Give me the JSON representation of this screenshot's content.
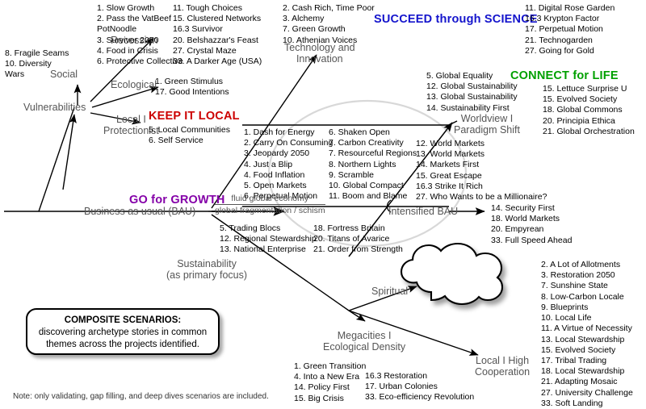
{
  "diagram": {
    "title_box": {
      "heading": "COMPOSITE SCENARIOS:",
      "body_line1": "discovering archetype stories in common",
      "body_line2": "themes across the projects identified."
    },
    "footnote": "Note: only validating, gap filling, and deep dives scenarios are included.",
    "colors": {
      "keep_it_local": "#cc0000",
      "succeed_through_science": "#1414cc",
      "connect_for_life": "#00a000",
      "go_for_growth": "#8400a8",
      "node_label": "#555555"
    },
    "nodes": {
      "bau": "Business as usual (BAU)",
      "vulnerabilities": "Vulnerabilities",
      "social": "Social",
      "ecological": "Ecological",
      "recession": "Recession",
      "local_protectionist_l1": "Local I",
      "local_protectionist_l2": "Protectionist",
      "technology_l1": "Technology and",
      "technology_l2": "Innovation",
      "worldview_l1": "Worldview I",
      "worldview_l2": "Paradigm Shift",
      "intensified_bau": "Intensified BAU",
      "sustainability_l1": "Sustainability",
      "sustainability_l2": "(as primary focus)",
      "spiritual": "Spiritual",
      "megacities_l1": "Megacities I",
      "megacities_l2": "Ecological Density",
      "local_high_coop_l1": "Local I High",
      "local_high_coop_l2": "Cooperation"
    },
    "fraction": {
      "numerator": "fluid global economy",
      "denominator": "global fragmentation / schism"
    },
    "headings": {
      "keep_it_local": "KEEP IT LOCAL",
      "succeed_through_science": "SUCCEED through SCIENCE",
      "connect_for_life": "CONNECT for LIFE",
      "go_for_growth": "GO for GROWTH"
    },
    "lists": {
      "social": [
        "8. Fragile Seams",
        "10. Diversity",
        "Wars"
      ],
      "recession_col1": [
        "1. Slow Growth",
        "2. Pass the VatBeef",
        "PotNoodle",
        "3. Survivor 2050",
        "4. Food in Crisis",
        "6. Protective Collective"
      ],
      "recession_col2": [
        "11.  Tough Choices",
        "15. Clustered Networks",
        "16.3 Survivor",
        "20.  Belshazzar's Feast",
        "27. Crystal Maze",
        "33. A Darker Age (USA)"
      ],
      "ecological": [
        "1. Green Stimulus",
        "17. Good Intentions"
      ],
      "keep_it_local": [
        "5. Local Communities",
        "6. Self Service"
      ],
      "technology": [
        "2. Cash Rich, Time Poor",
        "3.  Alchemy",
        "7.  Green Growth",
        "10.  Athenian Voices"
      ],
      "succeed_through_science": [
        "11.  Digital Rose Garden",
        "16.3 Krypton Factor",
        "17. Perpetual Motion",
        "21. Technogarden",
        "27.  Going for Gold"
      ],
      "worldview": [
        "5.  Global Equality",
        "12.  Global Sustainability",
        "13.  Global Sustainability",
        "14.  Sustainability First"
      ],
      "connect_for_life": [
        "15.  Lettuce Surprise U",
        "15.  Evolved Society",
        "18.  Global Commons",
        "20.  Principia Ethica",
        "21.  Global Orchestration"
      ],
      "growth_col1": [
        "1. Dash for Energy",
        "2. Carry On Consuming",
        "3. Jeopardy 2050",
        "4. Just a Blip",
        "4. Food Inflation",
        "5. Open Markets",
        "6.  Perpetual Motion"
      ],
      "growth_col2": [
        "6. Shaken Open",
        "7. Carbon Creativity",
        "7. Resourceful Regions",
        "8. Northern Lights",
        "9. Scramble",
        "10. Global Compact",
        "11. Boom and Blame"
      ],
      "growth_col3": [
        "12. World Markets",
        "13. World Markets",
        "14. Markets First",
        "15. Great Escape",
        "16.3 Strike It Rich",
        "27. Who Wants to be a Millionaire?"
      ],
      "fragmentation_col1": [
        "5. Trading Blocs",
        "12. Regional Stewardship",
        "13. National Enterprise"
      ],
      "fragmentation_col2": [
        "18. Fortress Britain",
        "20. Titans of Avarice",
        "21. Order from Strength"
      ],
      "intensified_bau": [
        "14.  Security First",
        "18. World Markets",
        "20.  Empyrean",
        "33. Full Speed Ahead"
      ],
      "local_high_cooperation": [
        "2. A Lot of Allotments",
        "3. Restoration 2050",
        "7. Sunshine State",
        "8. Low-Carbon Locale",
        "9. Blueprints",
        "10. Local Life",
        "11. A Virtue of Necessity",
        "13. Local Stewardship",
        "15. Evolved Society",
        "17. Tribal Trading",
        "18. Local Stewardship",
        "21. Adapting Mosaic",
        "27. University Challenge",
        "33. Soft Landing"
      ],
      "megacities_col1": [
        "1.  Green Transition",
        "4. Into a New Era",
        "14. Policy First",
        "15. Big Crisis"
      ],
      "megacities_col2": [
        "16.3 Restoration",
        "17. Urban Colonies",
        "33. Eco-efficiency Revolution"
      ]
    }
  }
}
